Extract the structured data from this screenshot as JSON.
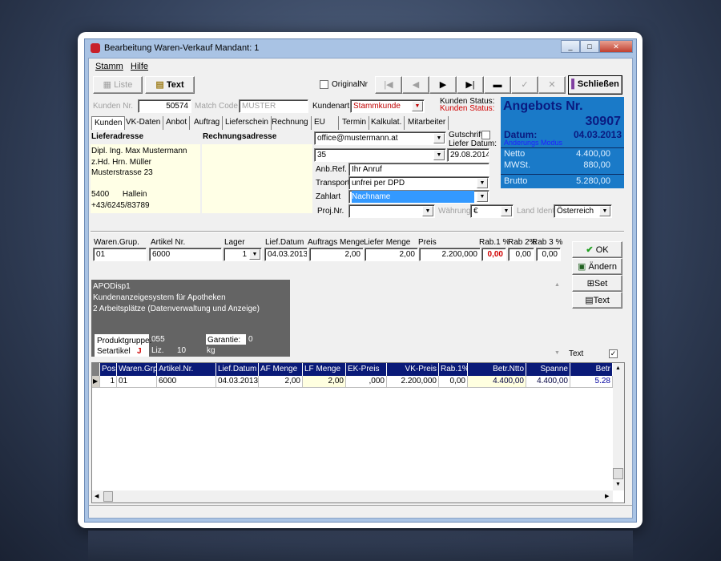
{
  "window": {
    "title": "Bearbeitung Waren-Verkauf  Mandant: 1",
    "controls": [
      "_",
      "□",
      "✕"
    ]
  },
  "menu": [
    "Stamm",
    "Hilfe"
  ],
  "toolbar": {
    "liste": "Liste",
    "text": "Text",
    "original_nr": "OriginalNr",
    "nav": [
      "|◀",
      "◀",
      "▶",
      "▶|",
      "▬",
      "✓",
      "✕"
    ],
    "close": "Schließen"
  },
  "header": {
    "kunden_nr_label": "Kunden Nr.",
    "kunden_nr": "50574",
    "match_code_label": "Match Code",
    "match_code": "MUSTER",
    "kundenart_label": "Kundenart:",
    "kundenart": "Stammkunde",
    "status_label": "Kunden Status:",
    "status_label2": "Kunden Status:"
  },
  "tabs": [
    "Kunden",
    "VK-Daten",
    "Anbot",
    "Auftrag",
    "Lieferschein",
    "Rechnung",
    "EU",
    "Termin",
    "Kalkulat.",
    "Mitarbeiter"
  ],
  "address": {
    "liefer_label": "Lieferadresse",
    "rechnung_label": "Rechnungsadresse",
    "lines": [
      "Dipl. Ing. Max Mustermann",
      "z.Hd. Hrn. Müller",
      "Musterstrasse 23",
      "",
      "5400      Hallein",
      "+43/6245/83789"
    ]
  },
  "form": {
    "email": "office@mustermann.at",
    "gutschrift": "Gutschrift",
    "liefer_datum_label": "Liefer Datum:",
    "field35": "35",
    "liefer_datum": "29.08.2014",
    "anb_ref_label": "Anb.Ref.",
    "anb_ref": "Ihr Anruf",
    "transport_label": "Transport",
    "transport": "unfrei per DPD",
    "zahlart_label": "Zahlart",
    "zahlart": "Nachname",
    "proj_label": "Proj.Nr.",
    "proj": "",
    "waehrung_label": "Währung",
    "waehrung": "€",
    "land_label": "Land Ident",
    "land": "Österreich"
  },
  "summary": {
    "title": "Angebots Nr.",
    "number": "30907",
    "datum_label": "Datum:",
    "datum": "04.03.2013",
    "mode": "Anderungs Modus",
    "netto_label": "Netto",
    "netto": "4.400,00",
    "mwst_label": "MWSt.",
    "mwst": "880,00",
    "brutto_label": "Brutto",
    "brutto": "5.280,00"
  },
  "article": {
    "labels": [
      "Waren.Grup.",
      "Artikel Nr.",
      "Lager",
      "Lief.Datum",
      "Auftrags Menge",
      "Liefer Menge",
      "Preis",
      "Rab.1 %",
      "Rab 2%",
      "Rab 3 %"
    ],
    "values": [
      "01",
      "6000",
      "1",
      "04.03.2013",
      "2,00",
      "2,00",
      "2.200,000",
      "0,00",
      "0,00",
      "0,00"
    ]
  },
  "side_buttons": [
    "OK",
    "Ändern",
    "Set",
    "Text"
  ],
  "description": {
    "lines": [
      "APODisp1",
      "Kundenanzeigesystem für Apotheken",
      "2 Arbeitsplätze (Datenverwaltung und Anzeige)"
    ],
    "produktgruppe_label": "Produktgruppe:",
    "produktgruppe": "055",
    "garantie_label": "Garantie:",
    "garantie": "0",
    "setartikel_label": "Setartikel",
    "setartikel": "J",
    "liz_label": "Liz.",
    "liz": "10",
    "unit": "kg"
  },
  "text_check": "Text",
  "grid": {
    "columns": [
      "Pos",
      "Waren.Grp",
      "Artikel.Nr.",
      "Lief.Datum",
      "AF Menge",
      "LF Menge",
      "EK-Preis",
      "VK-Preis",
      "Rab.1%",
      "Betr.Ntto",
      "Spanne",
      "Betr"
    ],
    "rows": [
      [
        "1",
        "01",
        "6000",
        "04.03.2013",
        "2,00",
        "2,00",
        ",000",
        "2.200,000",
        "0,00",
        "4.400,00",
        "4.400,00",
        "5.28"
      ]
    ]
  }
}
